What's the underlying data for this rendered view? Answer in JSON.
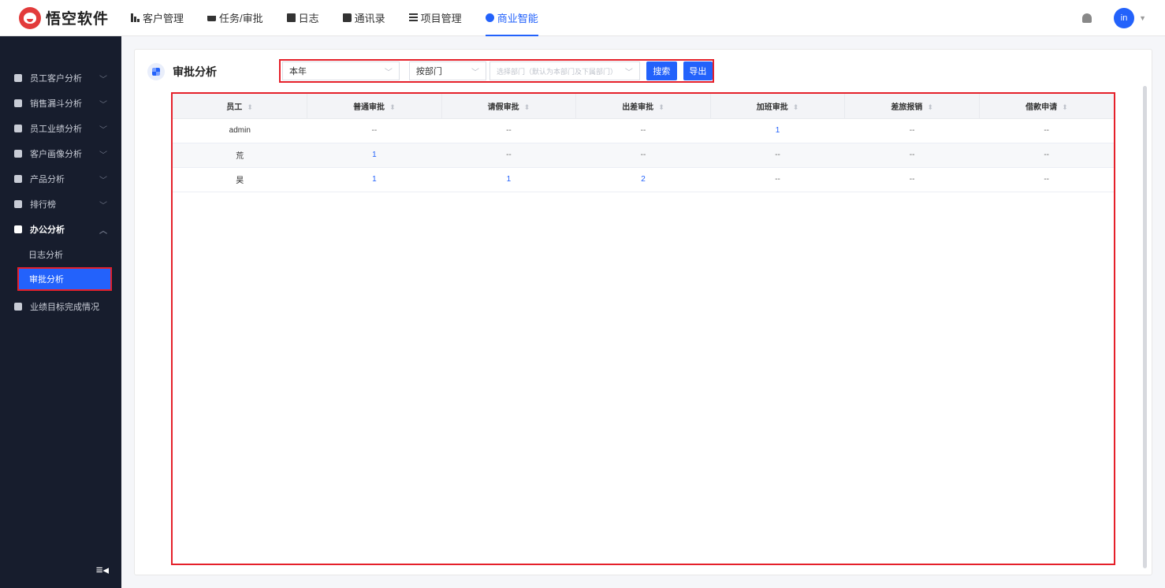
{
  "brand": {
    "name": "悟空软件"
  },
  "nav": [
    {
      "label": "客户管理",
      "icon": "building-icon"
    },
    {
      "label": "任务/审批",
      "icon": "briefcase-icon"
    },
    {
      "label": "日志",
      "icon": "log-icon"
    },
    {
      "label": "通讯录",
      "icon": "contacts-icon"
    },
    {
      "label": "项目管理",
      "icon": "project-icon"
    },
    {
      "label": "商业智能",
      "icon": "bi-shield-icon",
      "active": true
    }
  ],
  "user": {
    "avatar_text": "in"
  },
  "sidebar": {
    "items": [
      {
        "label": "员工客户分析"
      },
      {
        "label": "销售漏斗分析"
      },
      {
        "label": "员工业绩分析"
      },
      {
        "label": "客户画像分析"
      },
      {
        "label": "产品分析"
      },
      {
        "label": "排行榜"
      },
      {
        "label": "办公分析"
      },
      {
        "label": "业绩目标完成情况"
      }
    ],
    "sub_items": [
      {
        "label": "日志分析"
      },
      {
        "label": "审批分析",
        "active": true
      }
    ],
    "collapse_glyph": "≡◂"
  },
  "page": {
    "title": "审批分析",
    "filters": {
      "time": "本年",
      "scope": "按部门",
      "dept_placeholder": "选择部门（默认为本部门及下属部门）",
      "search_label": "搜索",
      "export_label": "导出"
    }
  },
  "table": {
    "headers": [
      "员工",
      "普通审批",
      "请假审批",
      "出差审批",
      "加班审批",
      "差旅报销",
      "借款申请"
    ],
    "rows": [
      [
        "admin",
        "--",
        "--",
        "--",
        "1",
        "--",
        "--"
      ],
      [
        "荒",
        "1",
        "--",
        "--",
        "--",
        "--",
        "--"
      ],
      [
        "昊",
        "1",
        "1",
        "2",
        "--",
        "--",
        "--"
      ]
    ]
  },
  "colors": {
    "accent": "#2362fb",
    "sidebar_bg": "#171d2d",
    "highlight_border": "#e5202a"
  }
}
